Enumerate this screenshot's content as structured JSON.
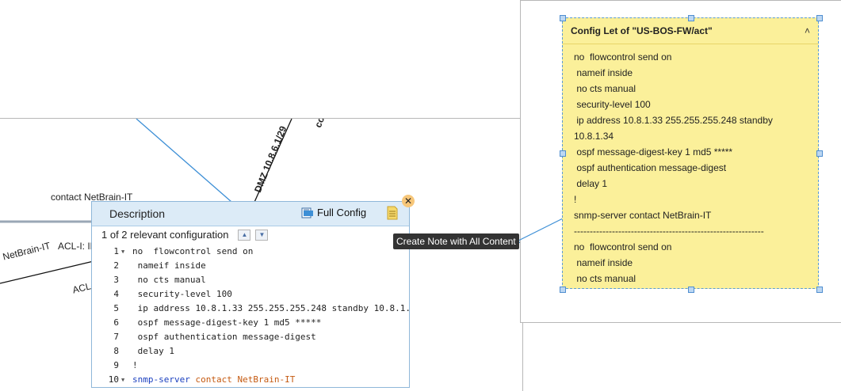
{
  "map": {
    "labels": {
      "dmz_link": "DMZ 10.8.6.1/29",
      "co_link": "co",
      "contact": "contact NetBrain-IT",
      "netbrain": "NetBrain-IT",
      "acl_in": "ACL-I: IN",
      "acl_out": "ACL-I"
    }
  },
  "description_panel": {
    "title": "Description",
    "full_config_label": "Full Config",
    "relevant_text": "1 of 2 relevant configuration",
    "close_symbol": "✕",
    "code_lines": [
      {
        "num": "1",
        "fold": true,
        "text": "no  flowcontrol send on"
      },
      {
        "num": "2",
        "fold": false,
        "text": " nameif inside"
      },
      {
        "num": "3",
        "fold": false,
        "text": " no cts manual"
      },
      {
        "num": "4",
        "fold": false,
        "text": " security-level 100"
      },
      {
        "num": "5",
        "fold": false,
        "text": " ip address 10.8.1.33 255.255.255.248 standby 10.8.1."
      },
      {
        "num": "6",
        "fold": false,
        "text": " ospf message-digest-key 1 md5 *****"
      },
      {
        "num": "7",
        "fold": false,
        "text": " ospf authentication message-digest"
      },
      {
        "num": "8",
        "fold": false,
        "text": " delay 1"
      },
      {
        "num": "9",
        "fold": false,
        "text": "!"
      },
      {
        "num": "10",
        "fold": true,
        "text_keyword": "snmp-server",
        "text_mid": " contact ",
        "text_value": "NetBrain-IT"
      }
    ]
  },
  "tooltip": {
    "text": "Create Note with All Content"
  },
  "note": {
    "title": "Config Let of \"US-BOS-FW/act\"",
    "collapse_symbol": "˄",
    "lines": [
      "no  flowcontrol send on",
      " nameif inside",
      " no cts manual",
      " security-level 100",
      " ip address 10.8.1.33 255.255.255.248 standby",
      "10.8.1.34",
      " ospf message-digest-key 1 md5 *****",
      " ospf authentication message-digest",
      " delay 1",
      "!",
      "snmp-server contact NetBrain-IT",
      "------------------------------------------------------------",
      "no  flowcontrol send on",
      " nameif inside",
      " no cts manual"
    ]
  },
  "colors": {
    "note_bg": "#fbf09a",
    "link_blue": "#3d8fd6",
    "header_blue": "#dcebf7",
    "keyword_blue": "#1a3fbf",
    "keyword_orange": "#c55a11"
  }
}
